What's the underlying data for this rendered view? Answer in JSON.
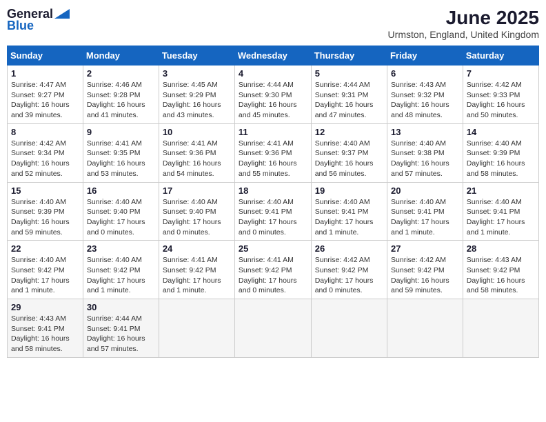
{
  "header": {
    "logo_general": "General",
    "logo_blue": "Blue",
    "title": "June 2025",
    "subtitle": "Urmston, England, United Kingdom"
  },
  "calendar": {
    "days_of_week": [
      "Sunday",
      "Monday",
      "Tuesday",
      "Wednesday",
      "Thursday",
      "Friday",
      "Saturday"
    ],
    "weeks": [
      [
        {
          "day": "1",
          "info": "Sunrise: 4:47 AM\nSunset: 9:27 PM\nDaylight: 16 hours and 39 minutes."
        },
        {
          "day": "2",
          "info": "Sunrise: 4:46 AM\nSunset: 9:28 PM\nDaylight: 16 hours and 41 minutes."
        },
        {
          "day": "3",
          "info": "Sunrise: 4:45 AM\nSunset: 9:29 PM\nDaylight: 16 hours and 43 minutes."
        },
        {
          "day": "4",
          "info": "Sunrise: 4:44 AM\nSunset: 9:30 PM\nDaylight: 16 hours and 45 minutes."
        },
        {
          "day": "5",
          "info": "Sunrise: 4:44 AM\nSunset: 9:31 PM\nDaylight: 16 hours and 47 minutes."
        },
        {
          "day": "6",
          "info": "Sunrise: 4:43 AM\nSunset: 9:32 PM\nDaylight: 16 hours and 48 minutes."
        },
        {
          "day": "7",
          "info": "Sunrise: 4:42 AM\nSunset: 9:33 PM\nDaylight: 16 hours and 50 minutes."
        }
      ],
      [
        {
          "day": "8",
          "info": "Sunrise: 4:42 AM\nSunset: 9:34 PM\nDaylight: 16 hours and 52 minutes."
        },
        {
          "day": "9",
          "info": "Sunrise: 4:41 AM\nSunset: 9:35 PM\nDaylight: 16 hours and 53 minutes."
        },
        {
          "day": "10",
          "info": "Sunrise: 4:41 AM\nSunset: 9:36 PM\nDaylight: 16 hours and 54 minutes."
        },
        {
          "day": "11",
          "info": "Sunrise: 4:41 AM\nSunset: 9:36 PM\nDaylight: 16 hours and 55 minutes."
        },
        {
          "day": "12",
          "info": "Sunrise: 4:40 AM\nSunset: 9:37 PM\nDaylight: 16 hours and 56 minutes."
        },
        {
          "day": "13",
          "info": "Sunrise: 4:40 AM\nSunset: 9:38 PM\nDaylight: 16 hours and 57 minutes."
        },
        {
          "day": "14",
          "info": "Sunrise: 4:40 AM\nSunset: 9:39 PM\nDaylight: 16 hours and 58 minutes."
        }
      ],
      [
        {
          "day": "15",
          "info": "Sunrise: 4:40 AM\nSunset: 9:39 PM\nDaylight: 16 hours and 59 minutes."
        },
        {
          "day": "16",
          "info": "Sunrise: 4:40 AM\nSunset: 9:40 PM\nDaylight: 17 hours and 0 minutes."
        },
        {
          "day": "17",
          "info": "Sunrise: 4:40 AM\nSunset: 9:40 PM\nDaylight: 17 hours and 0 minutes."
        },
        {
          "day": "18",
          "info": "Sunrise: 4:40 AM\nSunset: 9:41 PM\nDaylight: 17 hours and 0 minutes."
        },
        {
          "day": "19",
          "info": "Sunrise: 4:40 AM\nSunset: 9:41 PM\nDaylight: 17 hours and 1 minute."
        },
        {
          "day": "20",
          "info": "Sunrise: 4:40 AM\nSunset: 9:41 PM\nDaylight: 17 hours and 1 minute."
        },
        {
          "day": "21",
          "info": "Sunrise: 4:40 AM\nSunset: 9:41 PM\nDaylight: 17 hours and 1 minute."
        }
      ],
      [
        {
          "day": "22",
          "info": "Sunrise: 4:40 AM\nSunset: 9:42 PM\nDaylight: 17 hours and 1 minute."
        },
        {
          "day": "23",
          "info": "Sunrise: 4:40 AM\nSunset: 9:42 PM\nDaylight: 17 hours and 1 minute."
        },
        {
          "day": "24",
          "info": "Sunrise: 4:41 AM\nSunset: 9:42 PM\nDaylight: 17 hours and 1 minute."
        },
        {
          "day": "25",
          "info": "Sunrise: 4:41 AM\nSunset: 9:42 PM\nDaylight: 17 hours and 0 minutes."
        },
        {
          "day": "26",
          "info": "Sunrise: 4:42 AM\nSunset: 9:42 PM\nDaylight: 17 hours and 0 minutes."
        },
        {
          "day": "27",
          "info": "Sunrise: 4:42 AM\nSunset: 9:42 PM\nDaylight: 16 hours and 59 minutes."
        },
        {
          "day": "28",
          "info": "Sunrise: 4:43 AM\nSunset: 9:42 PM\nDaylight: 16 hours and 58 minutes."
        }
      ],
      [
        {
          "day": "29",
          "info": "Sunrise: 4:43 AM\nSunset: 9:41 PM\nDaylight: 16 hours and 58 minutes."
        },
        {
          "day": "30",
          "info": "Sunrise: 4:44 AM\nSunset: 9:41 PM\nDaylight: 16 hours and 57 minutes."
        },
        {
          "day": "",
          "info": ""
        },
        {
          "day": "",
          "info": ""
        },
        {
          "day": "",
          "info": ""
        },
        {
          "day": "",
          "info": ""
        },
        {
          "day": "",
          "info": ""
        }
      ]
    ]
  }
}
